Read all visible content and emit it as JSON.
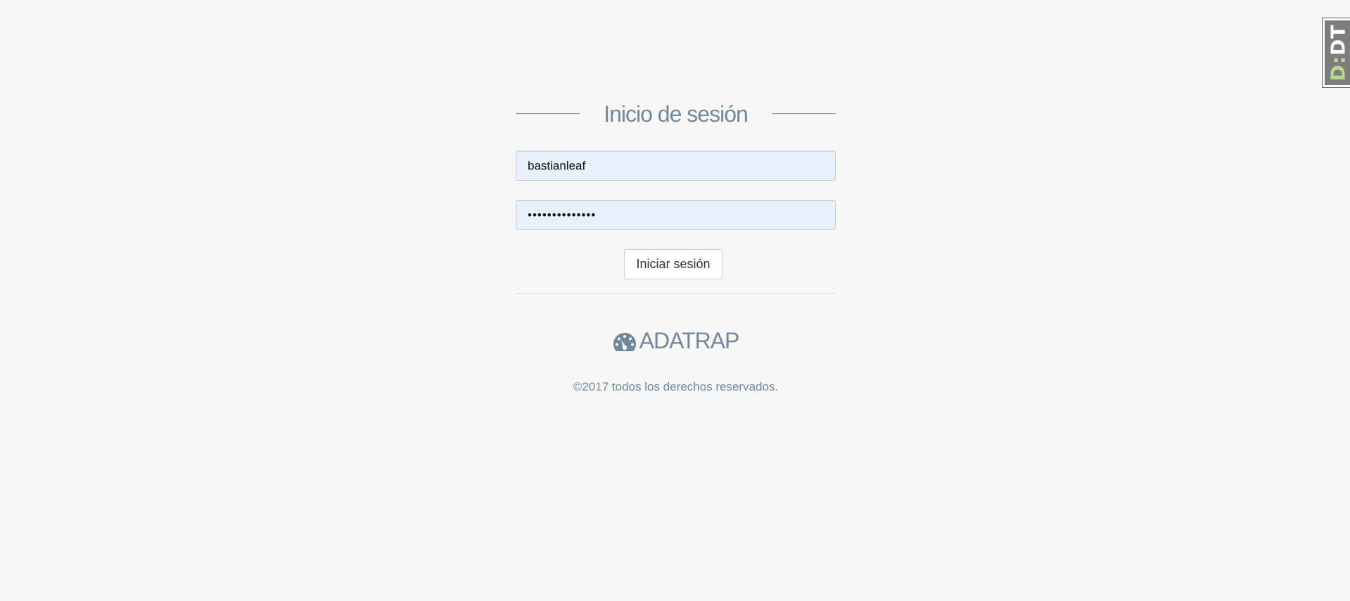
{
  "login": {
    "title": "Inicio de sesión",
    "username_value": "bastianleaf",
    "password_mask": "••••••••••••••",
    "submit_label": "Iniciar sesión"
  },
  "brand": {
    "name": "ADATRAP",
    "icon": "dashboard-gauge-icon"
  },
  "footer": {
    "copyright": "©2017 todos los derechos reservados."
  },
  "debug_toolbar": {
    "label_d": "D",
    "label_colon": ":",
    "label_rest": "DT",
    "icon": "django-debug-toolbar-handle"
  },
  "colors": {
    "background": "#f7f7f7",
    "muted_text": "#73879c",
    "input_autofill": "#e8f0fe",
    "ddt_green": "#b8d88f"
  }
}
